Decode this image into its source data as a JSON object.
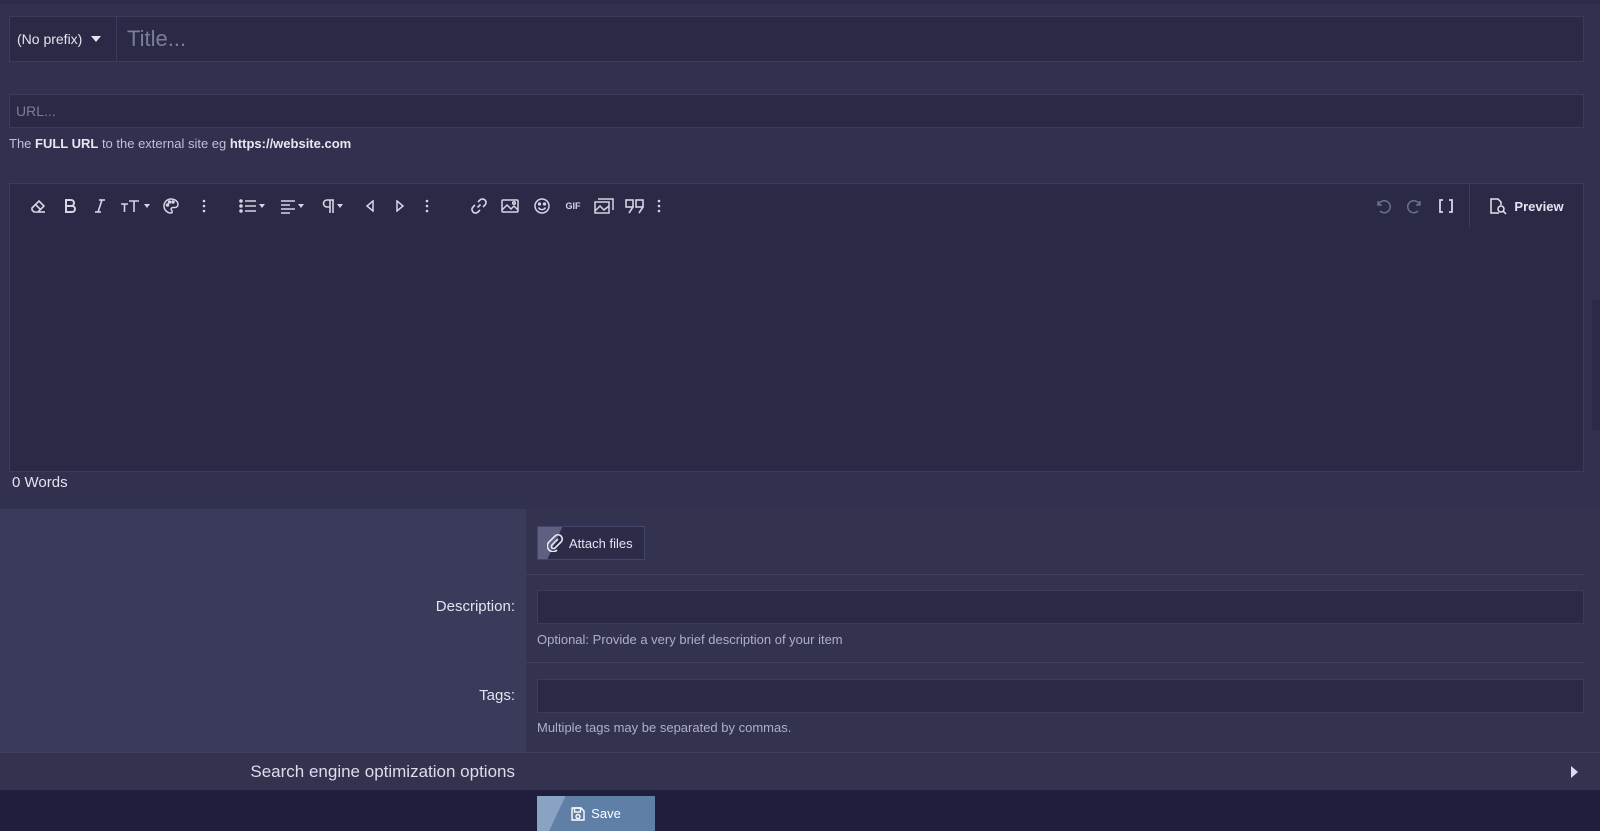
{
  "title_row": {
    "prefix_label": "(No prefix)",
    "title_placeholder": "Title..."
  },
  "url": {
    "placeholder": "URL...",
    "hint_before": "The ",
    "hint_bold1": "FULL URL",
    "hint_middle": " to the external site eg ",
    "hint_bold2": "https://website.com"
  },
  "editor": {
    "toolbar_icons": [
      "eraser-icon",
      "bold-icon",
      "italic-icon",
      "text-size-icon",
      "palette-icon",
      "more-icon",
      "list-icon",
      "align-icon",
      "paragraph-icon",
      "indent-decrease-icon",
      "indent-increase-icon",
      "more-icon",
      "link-icon",
      "image-icon",
      "smiley-icon",
      "gif-icon",
      "media-icon",
      "quote-icon",
      "more-icon",
      "undo-icon",
      "redo-icon",
      "bbcode-icon"
    ],
    "gif_label": "GIF",
    "preview_label": "Preview",
    "word_count": "0 Words"
  },
  "form": {
    "attach_label": "Attach files",
    "description_label": "Description:",
    "description_hint": "Optional: Provide a very brief description of your item",
    "tags_label": "Tags:",
    "tags_hint": "Multiple tags may be separated by commas.",
    "seo_label": "Search engine optimization options",
    "save_label": "Save"
  },
  "colors": {
    "background": "#31304f",
    "input_bg": "#2a2946",
    "footer_bg": "#1f1e3d",
    "save_button": "#5f7fa7"
  }
}
